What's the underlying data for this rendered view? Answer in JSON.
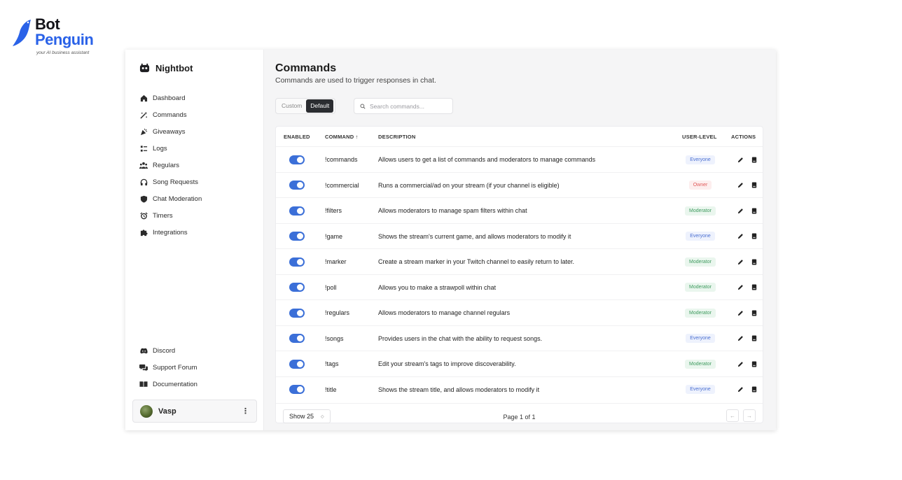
{
  "watermark": {
    "line1": "Bot",
    "line2": "Penguin",
    "tagline": "your AI business assistant"
  },
  "sidebar": {
    "brand": "Nightbot",
    "items": [
      {
        "label": "Dashboard",
        "icon": "home-icon"
      },
      {
        "label": "Commands",
        "icon": "magic-wand-icon"
      },
      {
        "label": "Giveaways",
        "icon": "party-icon"
      },
      {
        "label": "Logs",
        "icon": "list-icon"
      },
      {
        "label": "Regulars",
        "icon": "users-icon"
      },
      {
        "label": "Song Requests",
        "icon": "headphones-icon"
      },
      {
        "label": "Chat Moderation",
        "icon": "shield-icon"
      },
      {
        "label": "Timers",
        "icon": "alarm-icon"
      },
      {
        "label": "Integrations",
        "icon": "puzzle-icon"
      }
    ],
    "bottom_items": [
      {
        "label": "Discord",
        "icon": "discord-icon"
      },
      {
        "label": "Support Forum",
        "icon": "forum-icon"
      },
      {
        "label": "Documentation",
        "icon": "book-icon"
      }
    ],
    "user": {
      "name": "Vasp",
      "menu": "⋮"
    }
  },
  "main": {
    "title": "Commands",
    "subtitle": "Commands are used to trigger responses in chat.",
    "tabs": {
      "custom": "Custom",
      "default": "Default"
    },
    "search_placeholder": "Search commands...",
    "columns": {
      "enabled": "ENABLED",
      "command": "COMMAND ↑",
      "description": "DESCRIPTION",
      "userlevel": "USER-LEVEL",
      "actions": "ACTIONS"
    },
    "rows": [
      {
        "command": "!commands",
        "description": "Allows users to get a list of commands and moderators to manage commands",
        "level": "Everyone"
      },
      {
        "command": "!commercial",
        "description": "Runs a commercial/ad on your stream (if your channel is eligible)",
        "level": "Owner"
      },
      {
        "command": "!filters",
        "description": "Allows moderators to manage spam filters within chat",
        "level": "Moderator"
      },
      {
        "command": "!game",
        "description": "Shows the stream's current game, and allows moderators to modify it",
        "level": "Everyone"
      },
      {
        "command": "!marker",
        "description": "Create a stream marker in your Twitch channel to easily return to later.",
        "level": "Moderator"
      },
      {
        "command": "!poll",
        "description": "Allows you to make a strawpoll within chat",
        "level": "Moderator"
      },
      {
        "command": "!regulars",
        "description": "Allows moderators to manage channel regulars",
        "level": "Moderator"
      },
      {
        "command": "!songs",
        "description": "Provides users in the chat with the ability to request songs.",
        "level": "Everyone"
      },
      {
        "command": "!tags",
        "description": "Edit your stream's tags to improve discoverability.",
        "level": "Moderator"
      },
      {
        "command": "!title",
        "description": "Shows the stream title, and allows moderators to modify it",
        "level": "Everyone"
      }
    ],
    "footer": {
      "show": "Show 25",
      "page": "Page 1 of 1",
      "prev": "←",
      "next": "→"
    }
  },
  "colors": {
    "accent": "#3b6fd8",
    "everyone_bg": "#eef2fd",
    "everyone_fg": "#4a6fd1",
    "owner_bg": "#fdeeee",
    "owner_fg": "#e05a5a",
    "moderator_bg": "#eaf6ee",
    "moderator_fg": "#3f9b5f"
  }
}
